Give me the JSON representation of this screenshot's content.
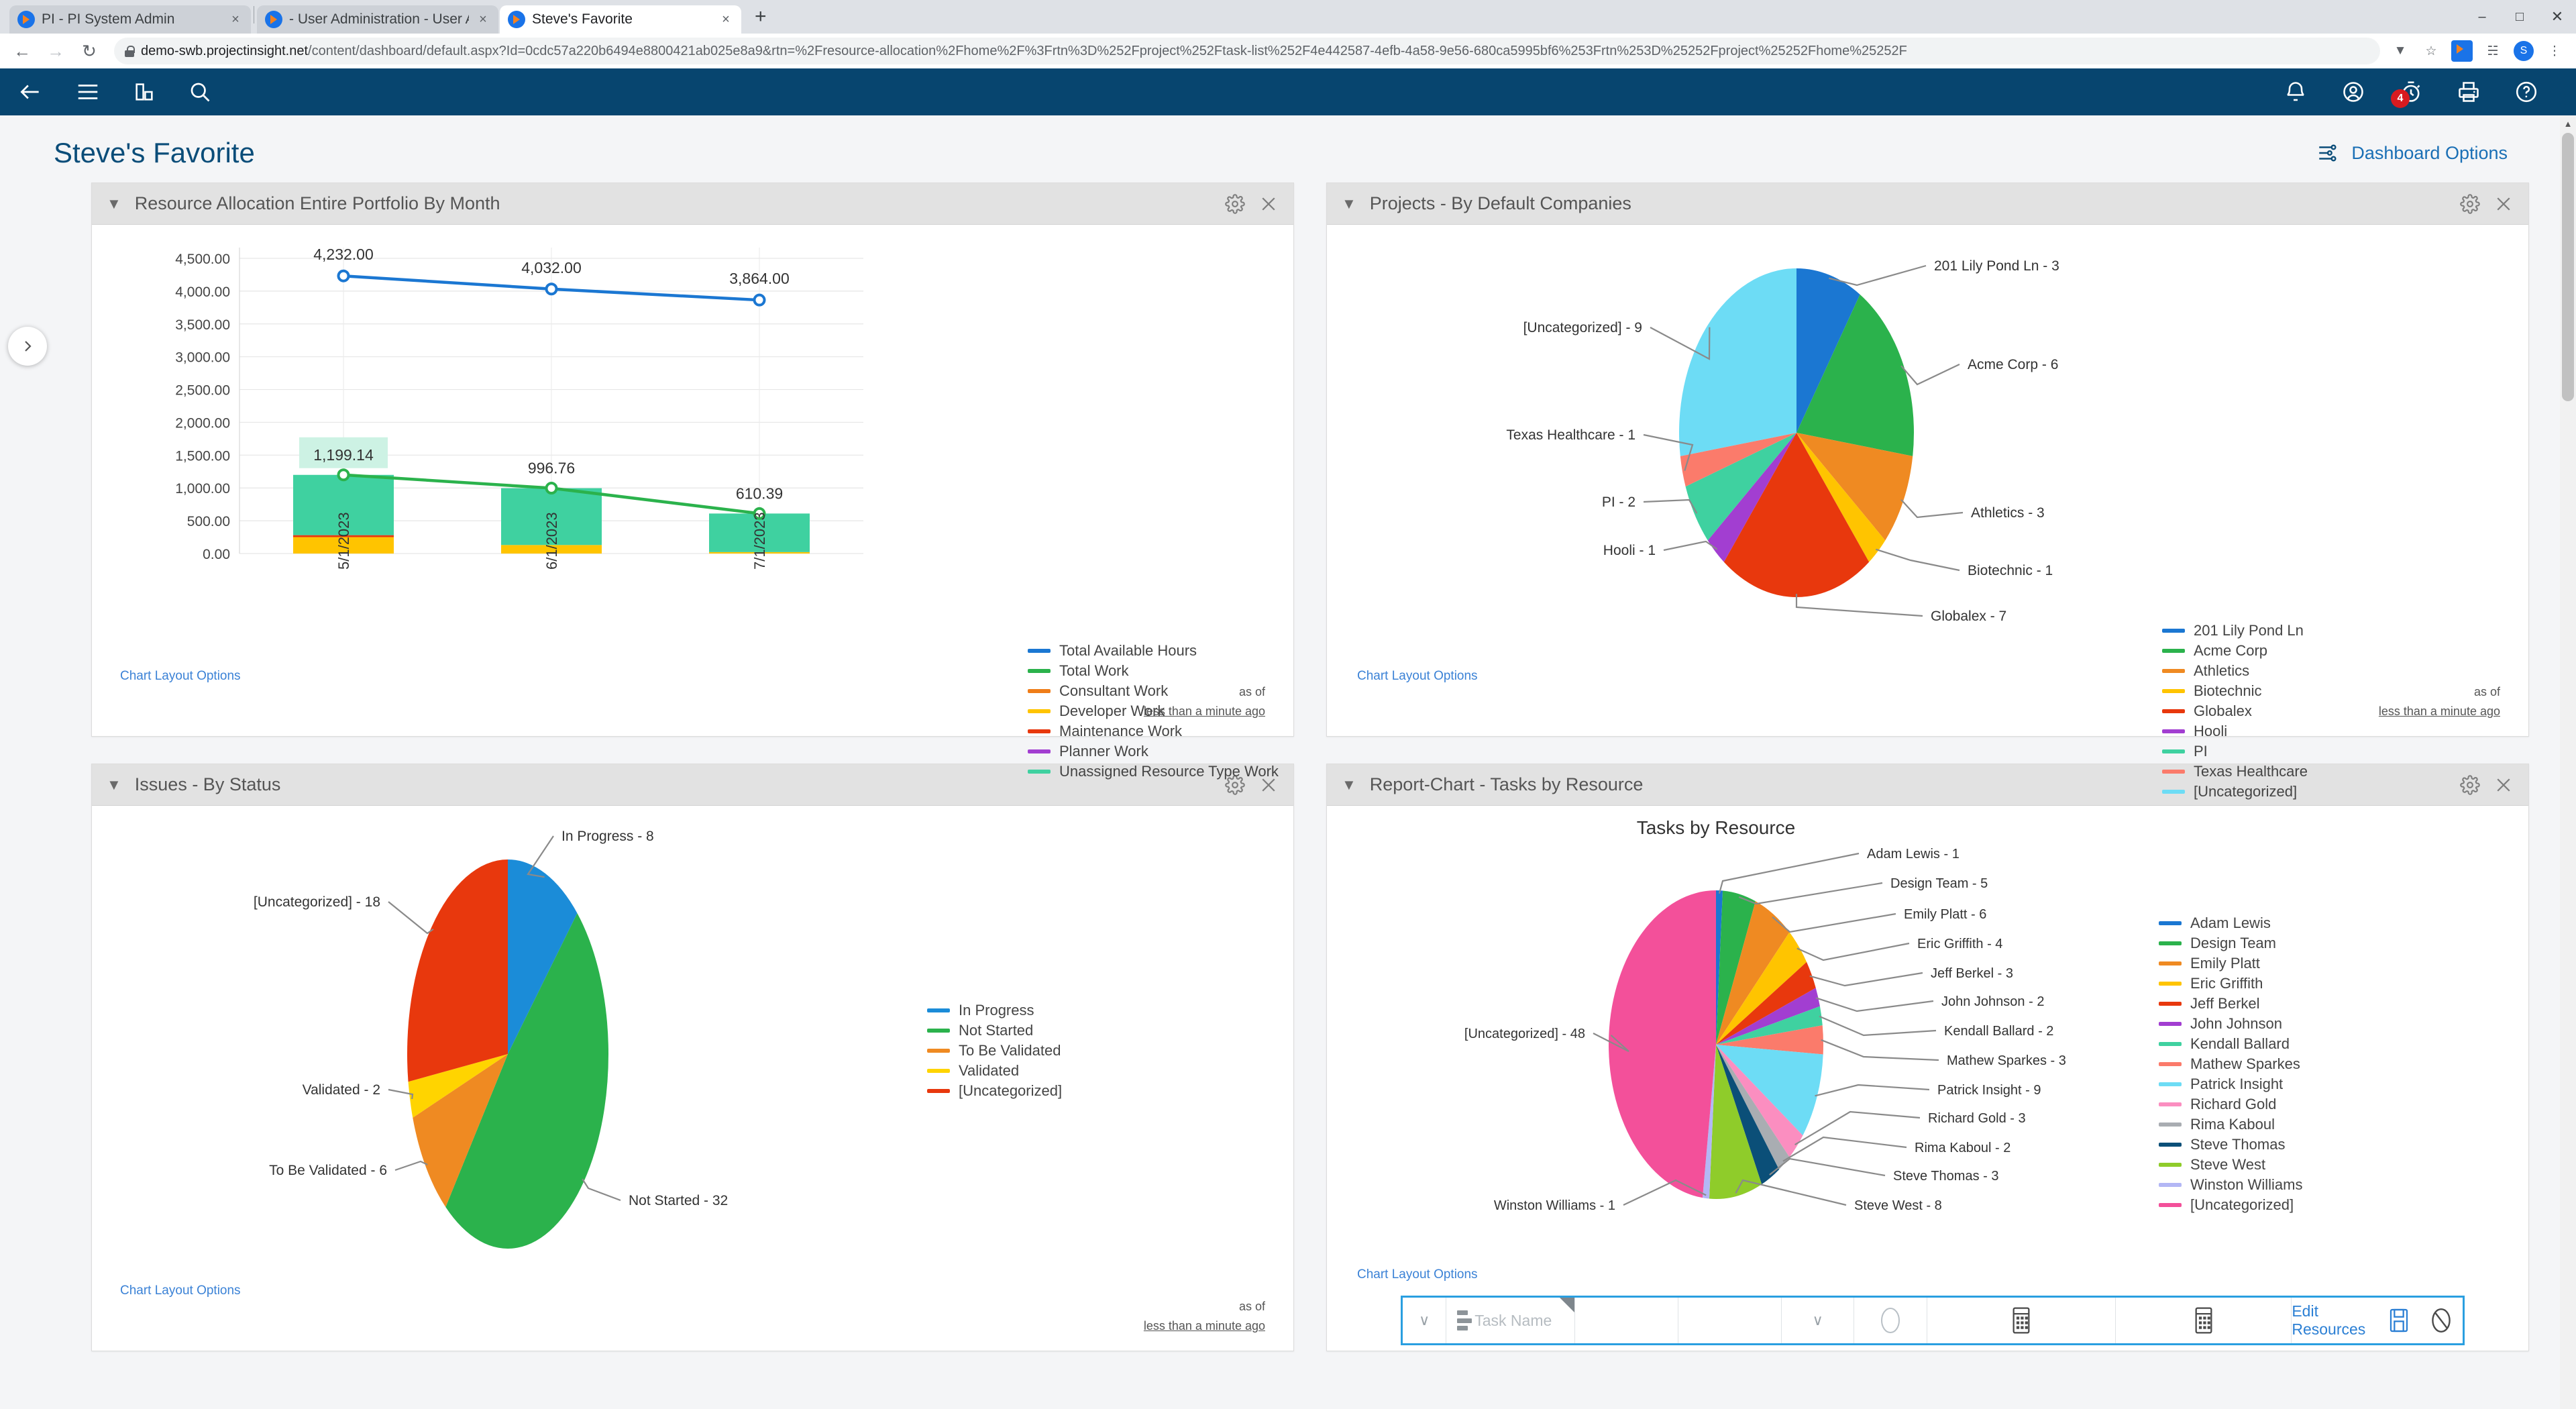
{
  "browser": {
    "tabs": [
      {
        "title": "PI - PI System Admin",
        "active": false
      },
      {
        "title": "- User Administration - User Adm",
        "active": false
      },
      {
        "title": "Steve's Favorite",
        "active": true
      }
    ],
    "new_tab_label": "+",
    "close_label": "×",
    "window_controls": {
      "minimize": "–",
      "maximize": "□",
      "close": "✕"
    },
    "url_host": "demo-swb.projectinsight.net",
    "url_path": "/content/dashboard/default.aspx?Id=0cdc57a220b6494e8800421ab025e8a9&rtn=%2Fresource-allocation%2Fhome%2F%3Frtn%3D%252Fproject%252Ftask-list%252F4e442587-4efb-4a58-9e56-680ca5995bf6%253Frtn%253D%25252Fproject%25252Fhome%25252F",
    "back_label": "←",
    "forward_label": "→",
    "reload_label": "↻",
    "avatar_initial": "S",
    "menu_label": "⋮"
  },
  "appbar": {
    "back": "back-arrow",
    "menu": "hamburger",
    "reports": "bar-chart",
    "search": "search",
    "notifications": "bell",
    "account": "user",
    "timer": "stopwatch",
    "timer_badge": "4",
    "print": "printer",
    "help": "question"
  },
  "page": {
    "title": "Steve's Favorite",
    "dashboard_options_label": "Dashboard Options",
    "collapse_handle": "expand-sidebar"
  },
  "panels": [
    {
      "title": "Resource Allocation Entire Portfolio By Month",
      "chart_layout_link": "Chart Layout Options",
      "asof_label": "as of",
      "asof_value": "less than a minute ago",
      "gear": "settings-icon",
      "close": "close-icon"
    },
    {
      "title": "Projects - By Default Companies",
      "chart_layout_link": "Chart Layout Options",
      "asof_label": "as of",
      "asof_value": "less than a minute ago",
      "gear": "settings-icon",
      "close": "close-icon"
    },
    {
      "title": "Issues - By Status",
      "chart_layout_link": "Chart Layout Options",
      "asof_label": "as of",
      "asof_value": "less than a minute ago",
      "gear": "settings-icon",
      "close": "close-icon"
    },
    {
      "title": "Report-Chart - Tasks by Resource",
      "chart_layout_link": "Chart Layout Options",
      "asof_label": "",
      "asof_value": "",
      "gear": "settings-icon",
      "close": "close-icon"
    }
  ],
  "task_toolbar": {
    "task_name_placeholder": "Task Name",
    "edit_resources_label": "Edit Resources",
    "save_icon": "save-icon",
    "cancel_icon": "no-entry-icon",
    "calendar_icon": "calendar-icon",
    "chevron": "∨"
  },
  "chart_data": [
    {
      "type": "bar",
      "id": "resource-allocation",
      "title": "Resource Allocation Entire Portfolio By Month",
      "categories": [
        "5/1/2023",
        "6/1/2023",
        "7/1/2023"
      ],
      "ytick_labels": [
        "4,500.00",
        "4,000.00",
        "3,500.00",
        "3,000.00",
        "2,500.00",
        "2,000.00",
        "1,500.00",
        "1,000.00",
        "500.00",
        "0.00"
      ],
      "ylim": [
        0,
        4500
      ],
      "grid": true,
      "legend_position": "right",
      "series": [
        {
          "name": "Total Available Hours",
          "color": "#1b77d2",
          "type": "line",
          "values": [
            4232.0,
            4032.0,
            3864.0
          ],
          "labels": [
            "4,232.00",
            "4,032.00",
            "3,864.00"
          ]
        },
        {
          "name": "Total Work",
          "color": "#2bb24c",
          "type": "line",
          "values": [
            1199.14,
            996.76,
            610.39
          ],
          "labels": [
            "1,199.14",
            "996.76",
            "610.39"
          ]
        },
        {
          "name": "Consultant Work",
          "color": "#ef7d18",
          "type": "bar",
          "values": [
            0,
            0,
            0
          ]
        },
        {
          "name": "Developer Work",
          "color": "#ffc400",
          "type": "bar",
          "values": [
            250,
            130,
            22
          ]
        },
        {
          "name": "Maintenance Work",
          "color": "#e8380d",
          "type": "bar",
          "values": [
            30,
            0,
            0
          ]
        },
        {
          "name": "Planner Work",
          "color": "#a23ed1",
          "type": "bar",
          "values": [
            0,
            0,
            0
          ]
        },
        {
          "name": "Unassigned Resource Type Work",
          "color": "#3fd1a0",
          "type": "bar",
          "values": [
            919,
            866,
            588
          ]
        }
      ],
      "highlighted_label": "1,199.14"
    },
    {
      "type": "pie",
      "id": "projects-by-default-companies",
      "title": "",
      "legend_position": "right",
      "slices": [
        {
          "label": "201 Lily Pond Ln",
          "value": 3,
          "color": "#1b77d2"
        },
        {
          "label": "Acme Corp",
          "value": 6,
          "color": "#2bb24c"
        },
        {
          "label": "Athletics",
          "value": 3,
          "color": "#ef8a22"
        },
        {
          "label": "Biotechnic",
          "value": 1,
          "color": "#ffc400"
        },
        {
          "label": "Globalex",
          "value": 7,
          "color": "#e8380d"
        },
        {
          "label": "Hooli",
          "value": 1,
          "color": "#a23ed1"
        },
        {
          "label": "PI",
          "value": 2,
          "color": "#3fd1a0"
        },
        {
          "label": "Texas Healthcare",
          "value": 1,
          "color": "#fb7b6b"
        },
        {
          "label": "[Uncategorized]",
          "value": 9,
          "color": "#6ddcf5"
        }
      ]
    },
    {
      "type": "pie",
      "id": "issues-by-status",
      "title": "",
      "legend_position": "right",
      "slices": [
        {
          "label": "In Progress",
          "value": 8,
          "color": "#1b8cd8"
        },
        {
          "label": "Not Started",
          "value": 32,
          "color": "#2bb24c"
        },
        {
          "label": "To Be Validated",
          "value": 6,
          "color": "#ef8a22"
        },
        {
          "label": "Validated",
          "value": 2,
          "color": "#ffd400"
        },
        {
          "label": "[Uncategorized]",
          "value": 18,
          "color": "#e8380d"
        }
      ]
    },
    {
      "type": "pie",
      "id": "tasks-by-resource",
      "title": "Tasks by Resource",
      "legend_position": "right",
      "slices": [
        {
          "label": "Adam  Lewis",
          "value": 1,
          "color": "#1b77d2"
        },
        {
          "label": "Design Team",
          "value": 5,
          "color": "#2bb24c"
        },
        {
          "label": "Emily Platt",
          "value": 6,
          "color": "#ef8a22"
        },
        {
          "label": "Eric Griffith",
          "value": 4,
          "color": "#ffc400"
        },
        {
          "label": "Jeff Berkel",
          "value": 3,
          "color": "#e8380d"
        },
        {
          "label": "John Johnson",
          "value": 2,
          "color": "#a23ed1"
        },
        {
          "label": "Kendall Ballard",
          "value": 2,
          "color": "#3fd1a0"
        },
        {
          "label": "Mathew Sparkes",
          "value": 3,
          "color": "#fb7b6b"
        },
        {
          "label": "Patrick Insight",
          "value": 9,
          "color": "#6ddcf5"
        },
        {
          "label": "Richard Gold",
          "value": 3,
          "color": "#fb8ec0"
        },
        {
          "label": "Rima Kaboul",
          "value": 2,
          "color": "#a9adb2"
        },
        {
          "label": "Steve Thomas",
          "value": 3,
          "color": "#0b4f78"
        },
        {
          "label": "Steve West",
          "value": 8,
          "color": "#8fcc2a"
        },
        {
          "label": "Winston Williams",
          "value": 1,
          "color": "#b3b7f5"
        },
        {
          "label": "[Uncategorized]",
          "value": 48,
          "color": "#f3509a"
        }
      ]
    }
  ]
}
